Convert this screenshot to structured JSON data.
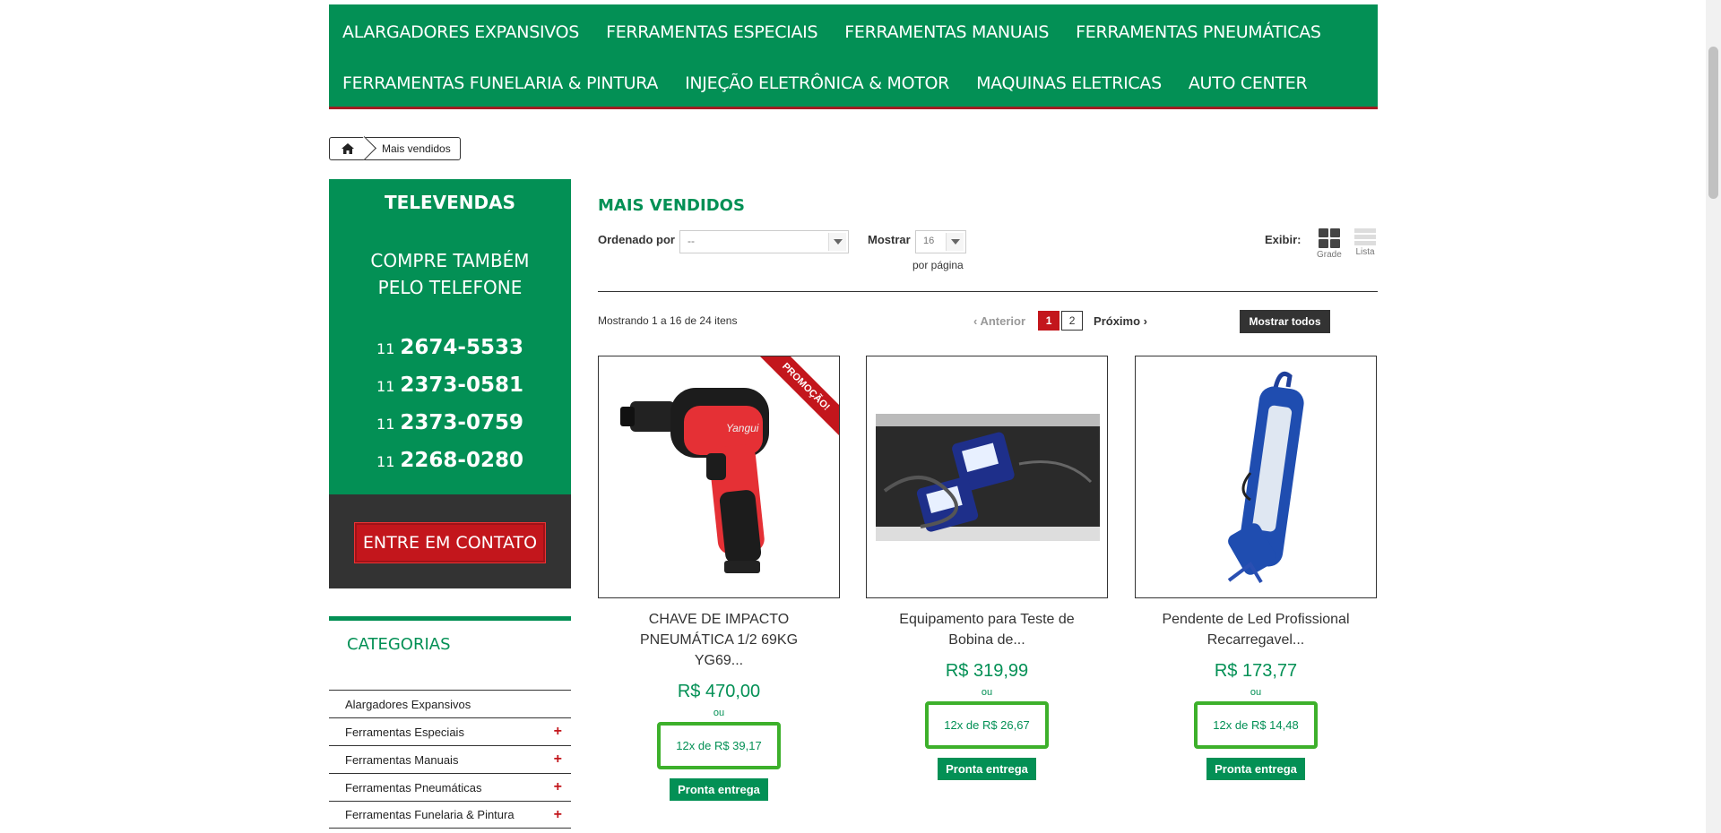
{
  "topnav": {
    "row1": [
      "ALARGADORES EXPANSIVOS",
      "FERRAMENTAS ESPECIAIS",
      "FERRAMENTAS MANUAIS",
      "FERRAMENTAS PNEUMÁTICAS"
    ],
    "row2": [
      "FERRAMENTAS FUNELARIA & PINTURA",
      "INJEÇÃO ELETRÔNICA & MOTOR",
      "MAQUINAS ELETRICAS",
      "AUTO CENTER"
    ]
  },
  "breadcrumb": {
    "home_icon": "home-icon",
    "current": "Mais vendidos"
  },
  "televendas": {
    "title": "TELEVENDAS",
    "line1": "COMPRE TAMBÉM",
    "line2": "PELO TELEFONE",
    "phones": [
      {
        "ddd": "11",
        "number": "2674-5533"
      },
      {
        "ddd": "11",
        "number": "2373-0581"
      },
      {
        "ddd": "11",
        "number": "2373-0759"
      },
      {
        "ddd": "11",
        "number": "2268-0280"
      }
    ],
    "contact_button": "ENTRE EM CONTATO"
  },
  "categories": {
    "title": "CATEGORIAS",
    "items": [
      {
        "label": "Alargadores Expansivos",
        "expand": ""
      },
      {
        "label": "Ferramentas Especiais",
        "expand": "+"
      },
      {
        "label": "Ferramentas Manuais",
        "expand": "+"
      },
      {
        "label": "Ferramentas Pneumáticas",
        "expand": "+"
      },
      {
        "label": "Ferramentas Funelaria & Pintura",
        "expand": "+"
      }
    ]
  },
  "main": {
    "title": "MAIS VENDIDOS",
    "sort_label": "Ordenado por",
    "sort_value": "--",
    "show_label": "Mostrar",
    "show_value": "16",
    "per_page": "por página",
    "view_label": "Exibir:",
    "view_grid": "Grade",
    "view_list": "Lista",
    "showing": "Mostrando 1 a 16 de 24 itens",
    "prev": "Anterior",
    "pages": [
      "1",
      "2"
    ],
    "next": "Próximo",
    "show_all": "Mostrar todos"
  },
  "products": [
    {
      "name_l1": "CHAVE DE IMPACTO",
      "name_l2": "PNEUMÁTICA 1/2 69KG",
      "name_l3": "YG69...",
      "price": "R$ 470,00",
      "ou": "ou",
      "installments": "12x de R$ 39,17",
      "stock": "Pronta entrega",
      "ribbon": "PROMOÇÃO!",
      "brand_text": "Yangui"
    },
    {
      "name_l1": "Equipamento para Teste de",
      "name_l2": "Bobina de...",
      "name_l3": "",
      "price": "R$ 319,99",
      "ou": "ou",
      "installments": "12x de R$ 26,67",
      "stock": "Pronta entrega"
    },
    {
      "name_l1": "Pendente de Led Profissional",
      "name_l2": "Recarregavel...",
      "name_l3": "",
      "price": "R$ 173,77",
      "ou": "ou",
      "installments": "12x de R$ 14,48",
      "stock": "Pronta entrega"
    }
  ],
  "colors": {
    "brand_green": "#039055",
    "accent_red": "#c3161c",
    "installment_border": "#3db02b"
  }
}
